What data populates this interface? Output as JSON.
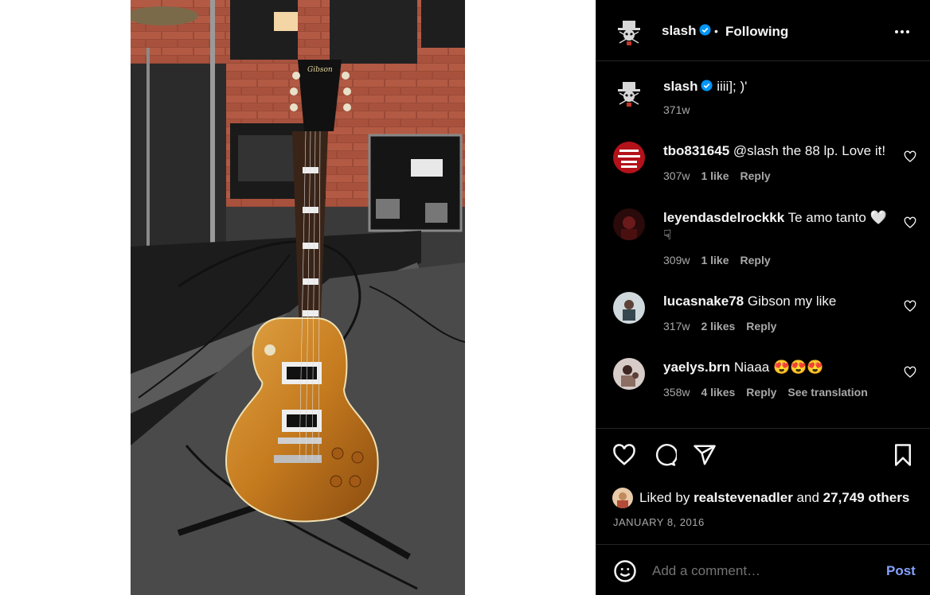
{
  "post": {
    "author": "slash",
    "follow_status": "Following",
    "dot": "•",
    "caption": "iiii]; )'",
    "caption_time": "371w"
  },
  "comments": [
    {
      "user": "tbo831645",
      "text": "@slash the 88 lp. Love it!",
      "time": "307w",
      "likes": "1 like",
      "reply": "Reply",
      "extra": ""
    },
    {
      "user": "leyendasdelrockkk",
      "text": "Te amo tanto 🤍 ☟",
      "time": "309w",
      "likes": "1 like",
      "reply": "Reply",
      "extra": ""
    },
    {
      "user": "lucasnake78",
      "text": "Gibson my like",
      "time": "317w",
      "likes": "2 likes",
      "reply": "Reply",
      "extra": ""
    },
    {
      "user": "yaelys.brn",
      "text": "Niaaa 😍😍😍",
      "time": "358w",
      "likes": "4 likes",
      "reply": "Reply",
      "extra": "See translation"
    }
  ],
  "likes": {
    "prefix": "Liked by",
    "user": "realstevenadler",
    "conj": "and",
    "others": "27,749 others"
  },
  "date": "JANUARY 8, 2016",
  "add_comment": {
    "placeholder": "Add a comment…",
    "post_label": "Post"
  },
  "icons": {
    "more": "more-options-icon",
    "like": "heart-icon",
    "comment": "comment-icon",
    "share": "share-icon",
    "save": "bookmark-icon",
    "emoji": "emoji-icon",
    "verified": "verified-badge-icon"
  },
  "colors": {
    "panel_bg": "#000000",
    "text": "#f5f5f5",
    "muted": "#a8a8a8",
    "post_button": "#85a1ff",
    "verified": "#0095f6"
  }
}
